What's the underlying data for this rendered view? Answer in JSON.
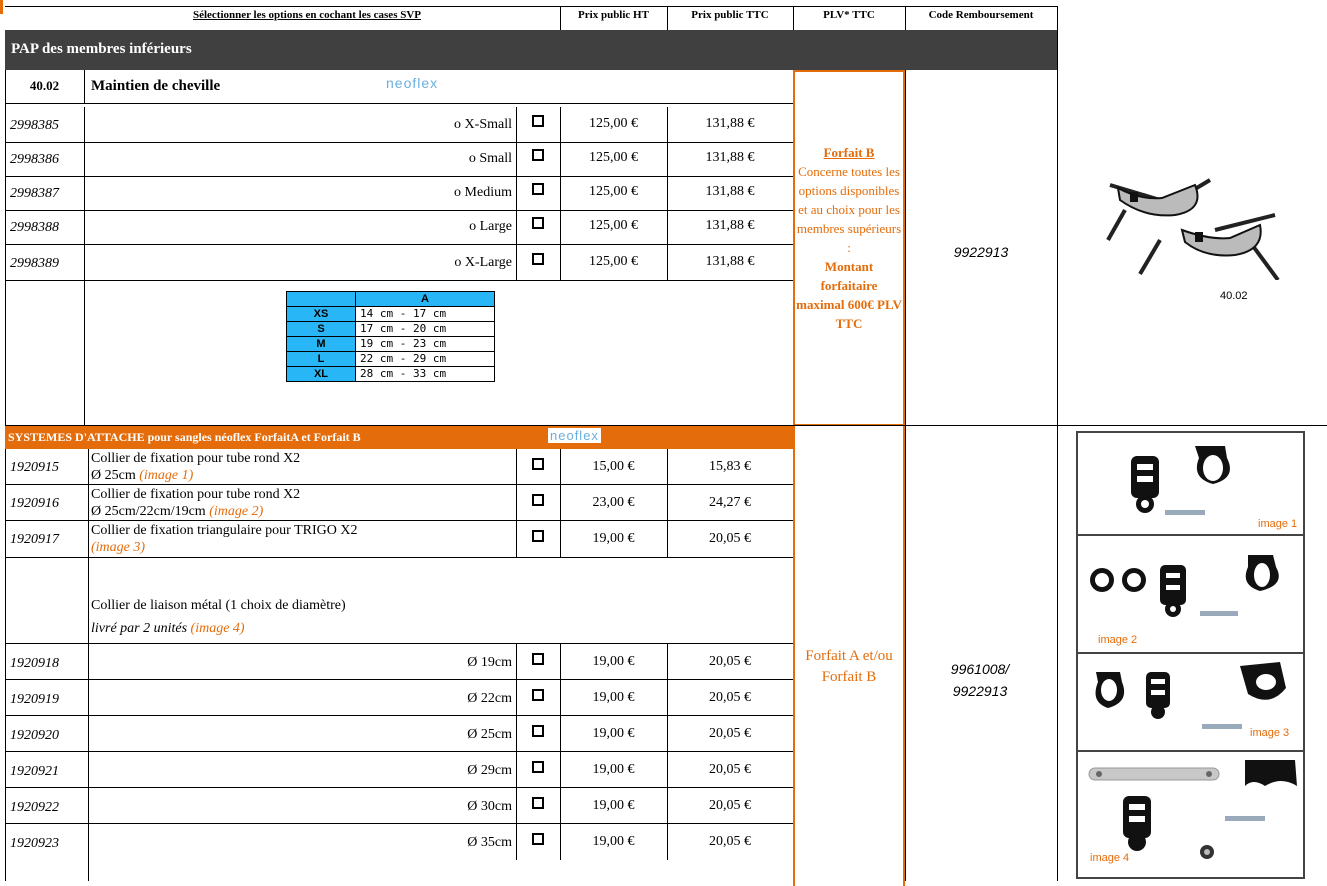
{
  "header": {
    "select_label": "Sélectionner les options en cochant les cases SVP",
    "price_ht": "Prix public HT",
    "price_ttc": "Prix public TTC",
    "plv": "PLV* TTC",
    "code_remb": "Code Remboursement"
  },
  "section1": {
    "title": "PAP des membres inférieurs",
    "ref": "40.02",
    "product": "Maintien de cheville",
    "brand": "neoflex",
    "rows": [
      {
        "code": "2998385",
        "option": "o X-Small",
        "ht": "125,00 €",
        "ttc": "131,88 €"
      },
      {
        "code": "2998386",
        "option": "o Small",
        "ht": "125,00 €",
        "ttc": "131,88 €"
      },
      {
        "code": "2998387",
        "option": "o Medium",
        "ht": "125,00 €",
        "ttc": "131,88 €"
      },
      {
        "code": "2998388",
        "option": "o Large",
        "ht": "125,00 €",
        "ttc": "131,88 €"
      },
      {
        "code": "2998389",
        "option": "o X-Large",
        "ht": "125,00 €",
        "ttc": "131,88 €"
      }
    ],
    "size_table": {
      "header": "A",
      "rows": [
        {
          "size": "XS",
          "range": "14 cm - 17 cm"
        },
        {
          "size": "S",
          "range": "17 cm - 20 cm"
        },
        {
          "size": "M",
          "range": "19 cm - 23 cm"
        },
        {
          "size": "L",
          "range": "22 cm - 29 cm"
        },
        {
          "size": "XL",
          "range": "28 cm - 33 cm"
        }
      ]
    },
    "plv": {
      "title": "Forfait B",
      "body": "Concerne toutes les options disponibles et au choix pour les membres supérieurs :",
      "bold": "Montant forfaitaire maximal 600€ PLV TTC"
    },
    "code_remb": "9922913",
    "image_caption": "40.02"
  },
  "section2": {
    "title": "SYSTEMES D'ATTACHE pour sangles néoflex  ForfaitA et Forfait B",
    "brand": "neoflex",
    "items": [
      {
        "code": "1920915",
        "line1": "Collier de fixation pour tube rond X2",
        "line2": "Ø 25cm ",
        "img": "(image 1)",
        "ht": "15,00 €",
        "ttc": "15,83 €"
      },
      {
        "code": "1920916",
        "line1": "Collier de fixation pour tube rond X2",
        "line2": "Ø 25cm/22cm/19cm  ",
        "img": "(image 2)",
        "ht": "23,00 €",
        "ttc": "24,27 €"
      },
      {
        "code": "1920917",
        "line1": "Collier de fixation triangulaire pour TRIGO  X2",
        "line2": "",
        "img": "(image 3)",
        "ht": "19,00 €",
        "ttc": "20,05 €"
      }
    ],
    "liaison": {
      "line1": "Collier de liaison métal (1 choix de diamètre)",
      "line2": "livré par 2 unités  ",
      "img": "(image 4)"
    },
    "diam_rows": [
      {
        "code": "1920918",
        "option": "Ø 19cm",
        "ht": "19,00 €",
        "ttc": "20,05 €"
      },
      {
        "code": "1920919",
        "option": "Ø 22cm",
        "ht": "19,00 €",
        "ttc": "20,05 €"
      },
      {
        "code": "1920920",
        "option": "Ø 25cm",
        "ht": "19,00 €",
        "ttc": "20,05 €"
      },
      {
        "code": "1920921",
        "option": "Ø 29cm",
        "ht": "19,00 €",
        "ttc": "20,05 €"
      },
      {
        "code": "1920922",
        "option": "Ø 30cm",
        "ht": "19,00 €",
        "ttc": "20,05 €"
      },
      {
        "code": "1920923",
        "option": "Ø 35cm",
        "ht": "19,00 €",
        "ttc": "20,05 €"
      }
    ],
    "plv": "Forfait A et/ou Forfait B",
    "code_remb": "9961008/ 9922913",
    "image_labels": [
      "image 1",
      "image 2",
      "image 3",
      "image 4"
    ]
  },
  "colors": {
    "orange": "#e46c0a",
    "dark_header": "#404040",
    "size_blue": "#29b6f6"
  }
}
